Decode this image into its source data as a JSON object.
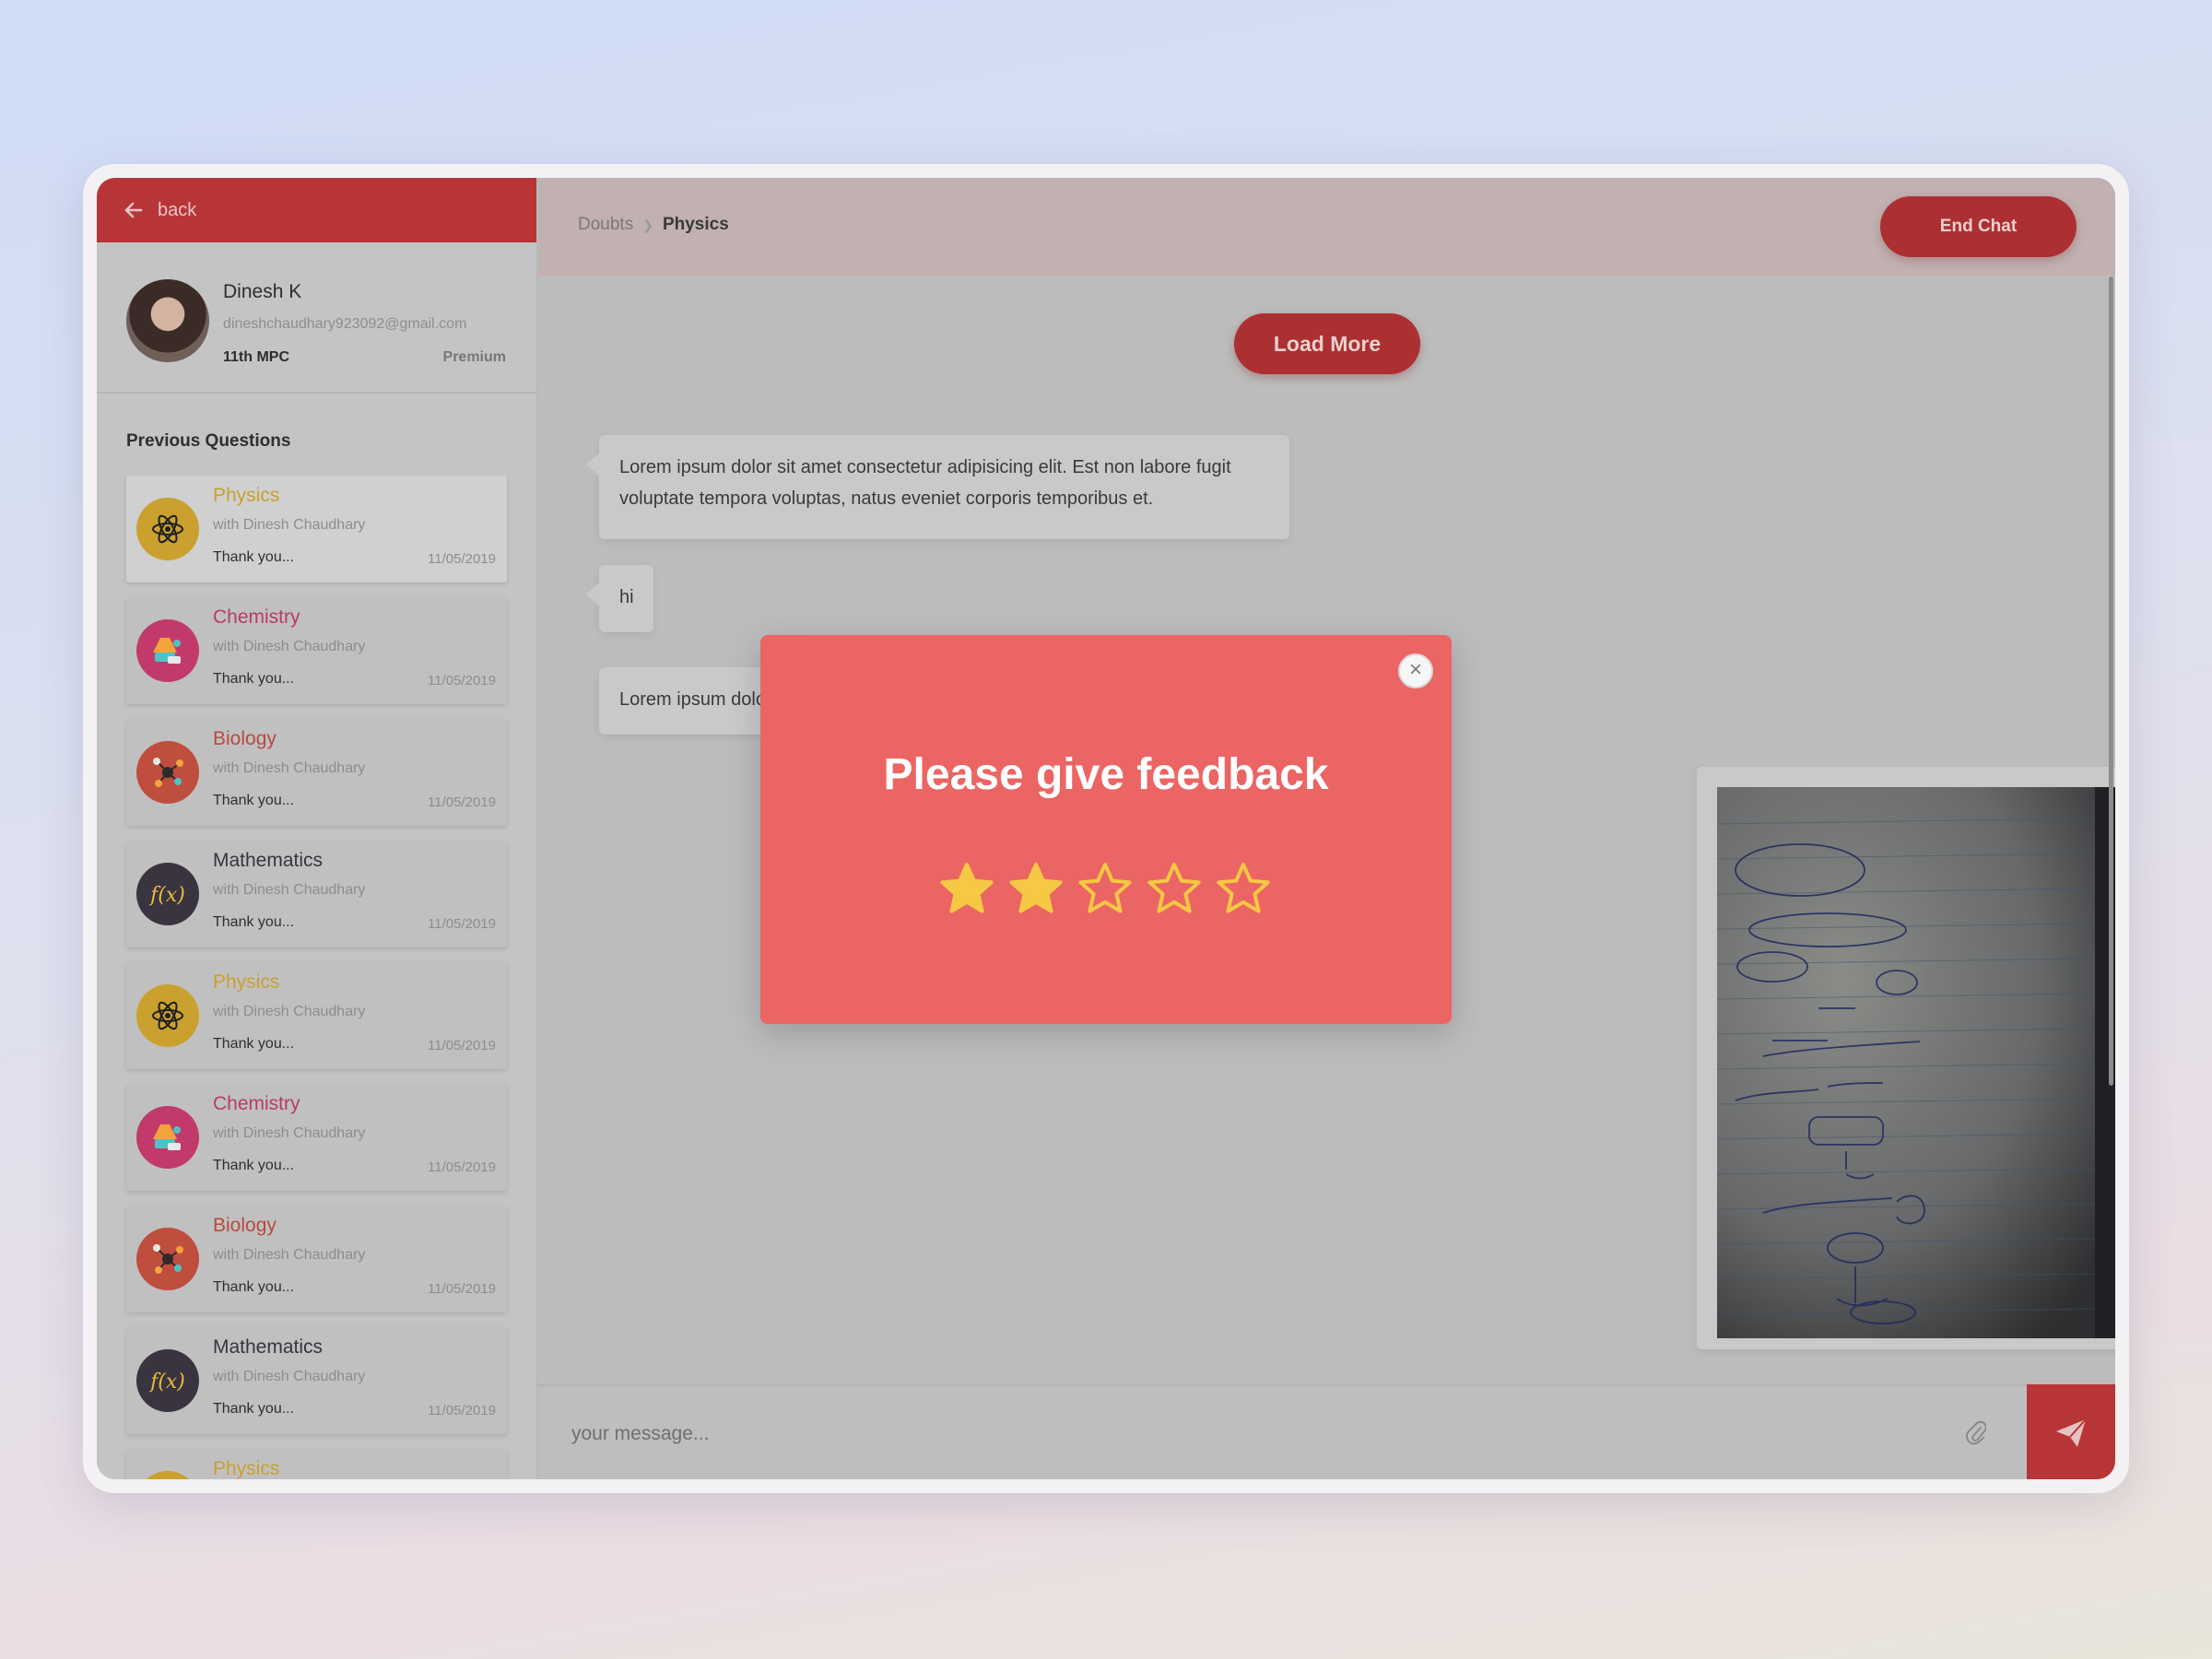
{
  "sidebar": {
    "back_label": "back",
    "profile": {
      "name": "Dinesh K",
      "email": "dineshchaudhary923092@gmail.com",
      "class": "11th MPC",
      "plan": "Premium"
    },
    "previous_title": "Previous Questions",
    "questions": [
      {
        "subject": "Physics",
        "with": "with Dinesh Chaudhary",
        "snippet": "Thank you...",
        "date": "11/05/2019",
        "icon": "atom-icon",
        "color": "#caa12f",
        "active": true
      },
      {
        "subject": "Chemistry",
        "with": "with Dinesh Chaudhary",
        "snippet": "Thank you...",
        "date": "11/05/2019",
        "icon": "flask-icon",
        "color": "#b83b6a"
      },
      {
        "subject": "Biology",
        "with": "with Dinesh Chaudhary",
        "snippet": "Thank you...",
        "date": "11/05/2019",
        "icon": "molecule-icon",
        "color": "#b84a3f"
      },
      {
        "subject": "Mathematics",
        "with": "with Dinesh Chaudhary",
        "snippet": "Thank you...",
        "date": "11/05/2019",
        "icon": "function-icon",
        "color": "#3a3340"
      },
      {
        "subject": "Physics",
        "with": "with Dinesh Chaudhary",
        "snippet": "Thank you...",
        "date": "11/05/2019",
        "icon": "atom-icon",
        "color": "#caa12f"
      },
      {
        "subject": "Chemistry",
        "with": "with Dinesh Chaudhary",
        "snippet": "Thank you...",
        "date": "11/05/2019",
        "icon": "flask-icon",
        "color": "#b83b6a"
      },
      {
        "subject": "Biology",
        "with": "with Dinesh Chaudhary",
        "snippet": "Thank you...",
        "date": "11/05/2019",
        "icon": "molecule-icon",
        "color": "#b84a3f"
      },
      {
        "subject": "Mathematics",
        "with": "with Dinesh Chaudhary",
        "snippet": "Thank you...",
        "date": "11/05/2019",
        "icon": "function-icon",
        "color": "#3a3340"
      },
      {
        "subject": "Physics",
        "with": "",
        "snippet": "",
        "date": "",
        "icon": "atom-icon",
        "color": "#caa12f"
      }
    ]
  },
  "header": {
    "breadcrumb": [
      "Doubts",
      "Physics"
    ],
    "end_chat_label": "End Chat"
  },
  "chat": {
    "load_more_label": "Load More",
    "messages": [
      "Lorem ipsum dolor sit amet consectetur adipisicing elit. Est non labore fugit voluptate tempora voluptas, natus eveniet corporis temporibus et.",
      "hi",
      "Lorem ipsum dolor sit amet consectetur adipisicing elit."
    ],
    "image_alt": "handwritten notebook page photo"
  },
  "composer": {
    "placeholder": "your message...",
    "attach_icon": "paperclip-icon",
    "send_icon": "paper-plane-icon"
  },
  "feedback_modal": {
    "title": "Please give feedback",
    "rating": 2,
    "max_rating": 5,
    "star_color": "#f6c843",
    "close_icon": "close-icon"
  },
  "colors": {
    "accent": "#b83537",
    "modal_bg": "#eb6564"
  }
}
